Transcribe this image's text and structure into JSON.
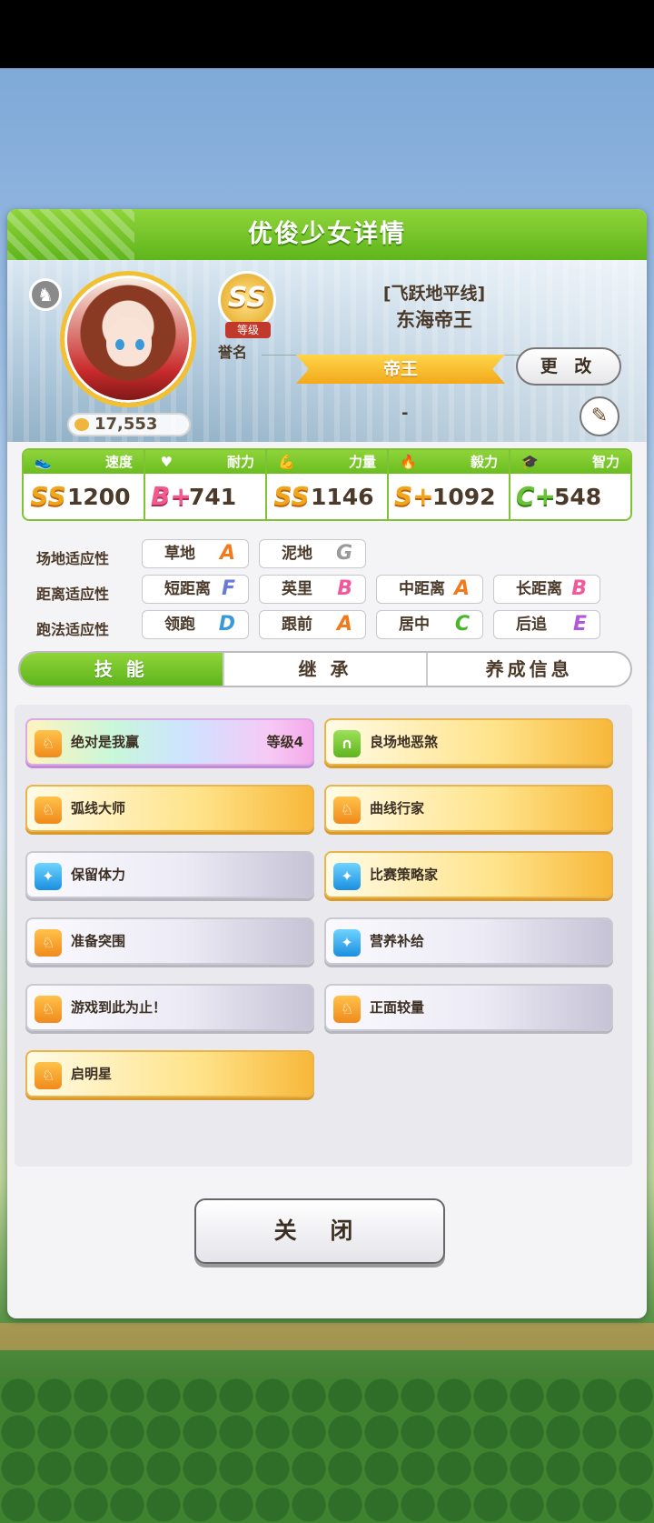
{
  "header": {
    "title": "优俊少女详情"
  },
  "profile": {
    "fans": "17,553",
    "rank": "SS",
    "rank_sub": "等级",
    "honor_label": "誉名",
    "alias": "[飞跃地平线]",
    "name": "东海帝王",
    "title": "帝王",
    "change_label": "更 改",
    "dash": "-"
  },
  "stats": [
    {
      "label": "速度",
      "grade": "SS",
      "value": "1200",
      "icon": "shoe-icon"
    },
    {
      "label": "耐力",
      "grade": "B+",
      "value": "741",
      "icon": "heart-icon"
    },
    {
      "label": "力量",
      "grade": "SS",
      "value": "1146",
      "icon": "muscle-icon"
    },
    {
      "label": "毅力",
      "grade": "S+",
      "value": "1092",
      "icon": "flame-icon"
    },
    {
      "label": "智力",
      "grade": "C+",
      "value": "548",
      "icon": "graduation-cap-icon"
    }
  ],
  "aptitude": {
    "track": {
      "label": "场地适应性",
      "items": [
        {
          "name": "草地",
          "grade": "A"
        },
        {
          "name": "泥地",
          "grade": "G"
        }
      ]
    },
    "distance": {
      "label": "距离适应性",
      "items": [
        {
          "name": "短距离",
          "grade": "F"
        },
        {
          "name": "英里",
          "grade": "B"
        },
        {
          "name": "中距离",
          "grade": "A"
        },
        {
          "name": "长距离",
          "grade": "B"
        }
      ]
    },
    "style": {
      "label": "跑法适应性",
      "items": [
        {
          "name": "领跑",
          "grade": "D"
        },
        {
          "name": "跟前",
          "grade": "A"
        },
        {
          "name": "居中",
          "grade": "C"
        },
        {
          "name": "后追",
          "grade": "E"
        }
      ]
    }
  },
  "tabs": [
    "技 能",
    "继 承",
    "养成信息"
  ],
  "skills": [
    {
      "name": "绝对是我赢",
      "level": "等级4",
      "style": "rainbow",
      "icon": "running-horse-icon"
    },
    {
      "name": "良场地恶煞",
      "style": "gold",
      "icon": "horseshoe-icon"
    },
    {
      "name": "弧线大师",
      "style": "gold",
      "icon": "running-horse-icon"
    },
    {
      "name": "曲线行家",
      "style": "gold",
      "icon": "running-horse-icon"
    },
    {
      "name": "保留体力",
      "style": "white",
      "icon": "sparkle-icon"
    },
    {
      "name": "比赛策略家",
      "style": "gold",
      "icon": "sparkle-icon"
    },
    {
      "name": "准备突围",
      "style": "white",
      "icon": "running-horse-icon"
    },
    {
      "name": "营养补给",
      "style": "white",
      "icon": "sparkle-icon"
    },
    {
      "name": "游戏到此为止！",
      "style": "white",
      "icon": "running-horse-icon"
    },
    {
      "name": "正面较量",
      "style": "white",
      "icon": "running-horse-icon"
    },
    {
      "name": "启明星",
      "style": "gold",
      "icon": "running-horse-icon"
    }
  ],
  "close_label": "关 闭",
  "colors": {
    "accent": "#6bbd1f",
    "gold": "#f3a91a"
  }
}
